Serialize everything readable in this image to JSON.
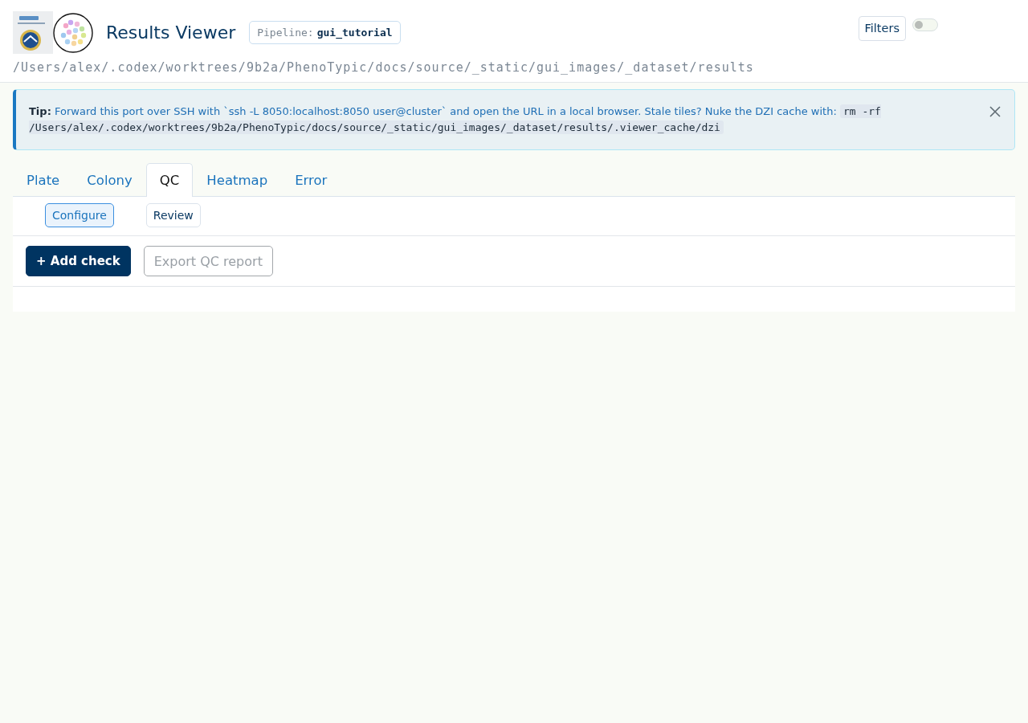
{
  "header": {
    "title": "Results Viewer",
    "pipeline": {
      "label": "Pipeline:",
      "value": "gui_tutorial"
    },
    "filters_button": {
      "label": "Filters"
    },
    "filters_toggle": {
      "on": false
    },
    "path": "/Users/alex/.codex/worktrees/9b2a/PhenoTypic/docs/source/_static/gui_images/_dataset/results"
  },
  "alert": {
    "label": "Tip:",
    "text": "Forward this port over SSH with `ssh -L 8050:localhost:8050 user@cluster` and open the URL in a local browser. Stale tiles? Nuke the DZI cache with:",
    "code": "rm -rf /Users/alex/.codex/worktrees/9b2a/PhenoTypic/docs/source/_static/gui_images/_dataset/results/.viewer_cache/dzi"
  },
  "tabs": [
    {
      "label": "Plate",
      "selected": false
    },
    {
      "label": "Colony",
      "selected": false
    },
    {
      "label": "QC",
      "selected": true
    },
    {
      "label": "Heatmap",
      "selected": false
    },
    {
      "label": "Error",
      "selected": false
    }
  ],
  "subtabs": [
    {
      "label": "Configure",
      "selected": true
    },
    {
      "label": "Review",
      "selected": false
    }
  ],
  "actions": [
    {
      "label": "+ Add check",
      "kind": "primary",
      "disabled": false
    },
    {
      "label": "Export QC report",
      "kind": "outline",
      "disabled": true
    }
  ]
}
